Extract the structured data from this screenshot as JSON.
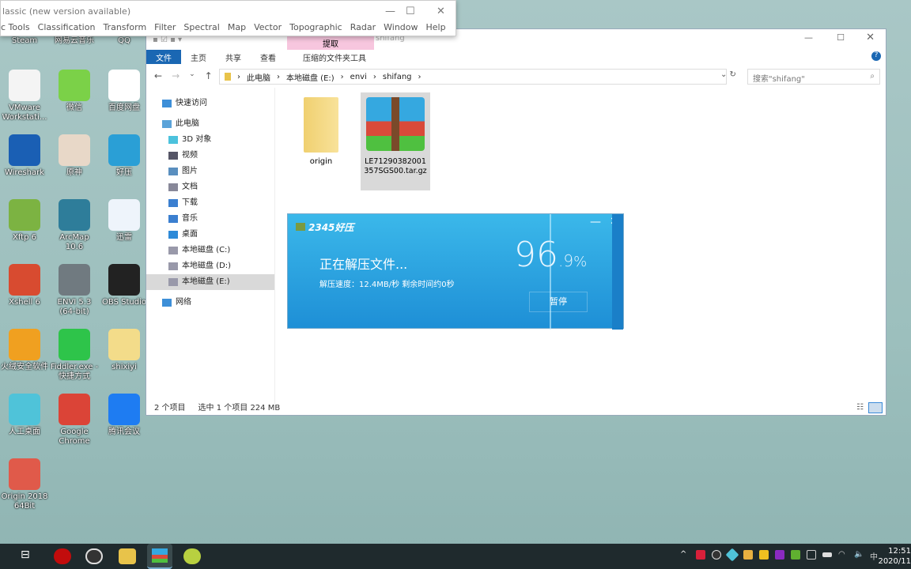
{
  "desktop": {
    "icons": [
      {
        "label": "Steam",
        "color": "#1b2838"
      },
      {
        "label": "网易云音乐",
        "color": "#c20c0c"
      },
      {
        "label": "QQ",
        "color": "#12b7f5"
      },
      {
        "label": "VMware Workstati...",
        "color": "#f4f4f4"
      },
      {
        "label": "微信",
        "color": "#7bd148"
      },
      {
        "label": "百度网盘",
        "color": "#ffffff"
      },
      {
        "label": "Wireshark",
        "color": "#1a5fb4"
      },
      {
        "label": "原神",
        "color": "#e8d8c8"
      },
      {
        "label": "好压",
        "color": "#2a9fd6"
      },
      {
        "label": "Xftp 6",
        "color": "#7cb342"
      },
      {
        "label": "ArcMap 10.6",
        "color": "#2e7d9a"
      },
      {
        "label": "迅雷",
        "color": "#eef4fb"
      },
      {
        "label": "Xshell 6",
        "color": "#d84b30"
      },
      {
        "label": "ENVI 5.3 (64-bit)",
        "color": "#707a80"
      },
      {
        "label": "OBS Studio",
        "color": "#222222"
      },
      {
        "label": "火绒安全软件",
        "color": "#f0a020"
      },
      {
        "label": "Fiddler.exe - 快捷方式",
        "color": "#2ec44a"
      },
      {
        "label": "shixiyi",
        "color": "#f3dc8a"
      },
      {
        "label": "人工桌面",
        "color": "#4fc3d9"
      },
      {
        "label": "Google Chrome",
        "color": "#db4437"
      },
      {
        "label": "腾讯会议",
        "color": "#1e7cf2"
      },
      {
        "label": "Origin 2018 64Bit",
        "color": "#e05a4a"
      }
    ]
  },
  "envi": {
    "title": "lassic (new version available)",
    "menu": [
      "c Tools",
      "Classification",
      "Transform",
      "Filter",
      "Spectral",
      "Map",
      "Vector",
      "Topographic",
      "Radar",
      "Window",
      "Help"
    ]
  },
  "explorer": {
    "context_tab": "提取",
    "window_title": "shifang",
    "tabs": [
      "文件",
      "主页",
      "共享",
      "查看"
    ],
    "context_tools": "压缩的文件夹工具",
    "breadcrumb": [
      "此电脑",
      "本地磁盘 (E:)",
      "envi",
      "shifang"
    ],
    "search_placeholder": "搜索\"shifang\"",
    "nav": [
      {
        "label": "快速访问",
        "color": "#3d8fd8"
      },
      {
        "label": "此电脑",
        "color": "#5ba3d9"
      },
      {
        "label": "3D 对象",
        "color": "#4cc2dd"
      },
      {
        "label": "视频",
        "color": "#556"
      },
      {
        "label": "图片",
        "color": "#5a8fbf"
      },
      {
        "label": "文档",
        "color": "#889"
      },
      {
        "label": "下载",
        "color": "#3b7fd0"
      },
      {
        "label": "音乐",
        "color": "#3b7fd0"
      },
      {
        "label": "桌面",
        "color": "#2e8ad8"
      },
      {
        "label": "本地磁盘 (C:)",
        "color": "#99a"
      },
      {
        "label": "本地磁盘 (D:)",
        "color": "#99a"
      },
      {
        "label": "本地磁盘 (E:)",
        "color": "#99a"
      },
      {
        "label": "网络",
        "color": "#3d8fd8"
      }
    ],
    "selected_nav": "本地磁盘 (E:)",
    "files": [
      {
        "name": "origin",
        "type": "folder"
      },
      {
        "name": "LE71290382001357SGS00.tar.gz",
        "type": "archive",
        "selected": true
      }
    ],
    "status": {
      "count": "2 个项目",
      "selected": "选中 1 个项目  224 MB"
    }
  },
  "haoya": {
    "brand": "2345好压",
    "message": "正在解压文件...",
    "speed": "解压速度：12.4MB/秒  剩余时间约0秒",
    "progress_int": "96",
    "progress_dec": ".9",
    "percent": "%",
    "progress_value": 96.9,
    "pause": "暂停"
  },
  "taskbar": {
    "time": "12:51",
    "date": "2020/11"
  }
}
